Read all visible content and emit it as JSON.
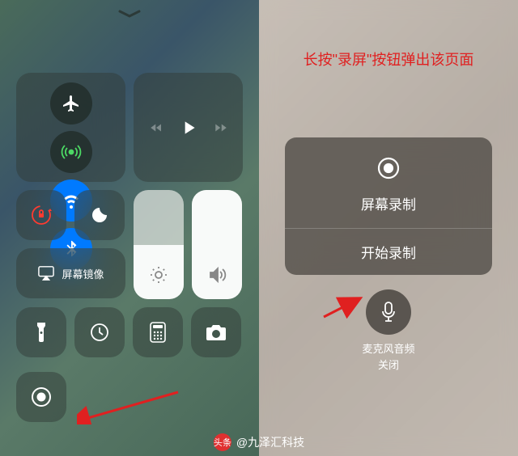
{
  "left": {
    "mirror_label": "屏幕镜像"
  },
  "right": {
    "instruction": "长按\"录屏\"按钮弹出该页面",
    "panel_title": "屏幕录制",
    "start_button": "开始录制",
    "mic_label_line1": "麦克风音频",
    "mic_label_line2": "关闭"
  },
  "watermark": {
    "prefix": "头条",
    "text": "@九泽汇科技"
  },
  "icons": {
    "airplane": "airplane-icon",
    "cellular": "cellular-icon",
    "wifi": "wifi-icon",
    "bluetooth": "bluetooth-icon",
    "prev": "prev-track-icon",
    "play": "play-icon",
    "next": "next-track-icon",
    "lock": "rotation-lock-icon",
    "dnd": "moon-icon",
    "mirror": "airplay-icon",
    "brightness": "sun-icon",
    "volume": "speaker-icon",
    "flashlight": "flashlight-icon",
    "timer": "timer-icon",
    "calculator": "calculator-icon",
    "camera": "camera-icon",
    "record": "record-icon",
    "mic": "microphone-icon"
  }
}
